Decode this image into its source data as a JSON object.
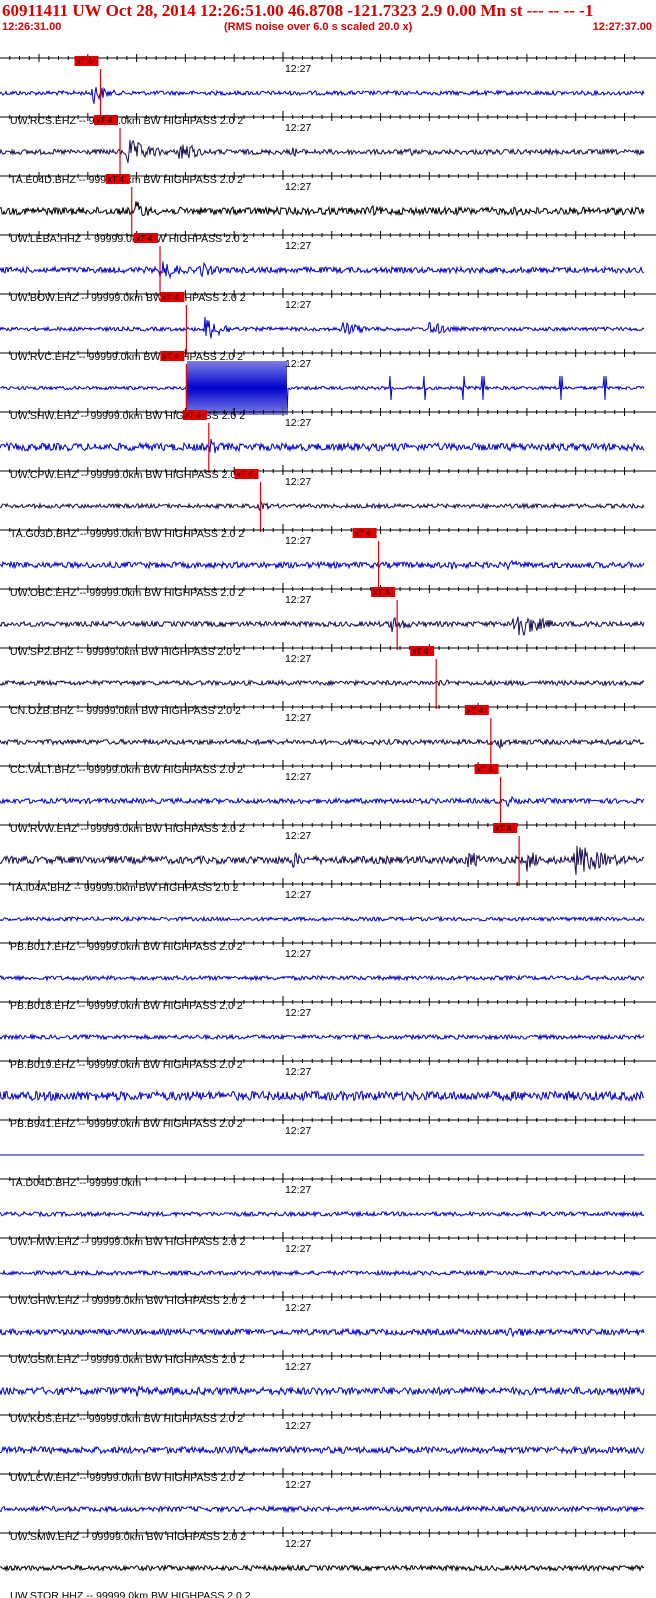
{
  "header": {
    "title": "60911411 UW Oct 28, 2014 12:26:51.00   46.8708 -121.7323  2.9 0.00 Mn st --- -- --  -1",
    "start_time": "12:26:31.00",
    "scale_note": "(RMS noise over 6.0 s scaled 20.0 x)",
    "end_time": "12:27:37.00"
  },
  "colors": {
    "title": "#d80000",
    "trace_blue": "#0000cc",
    "trace_dark": "#1a0a50",
    "trace_black": "#000000",
    "pick": "#e00000",
    "grid": "#000000"
  },
  "chart_data": {
    "type": "seismogram",
    "x_range_seconds": [
      0,
      66
    ],
    "minute_mark_label": "12:27",
    "minute_mark_second": 29,
    "traces": [
      {
        "label": "UW.RCS.EHZ -- 99999.0km BW  HIGHPASS  2.0  2",
        "pick_label": "xT 4",
        "pick_second": 10.3,
        "color": "blue",
        "level": 0.5,
        "events": [
          [
            9.5,
            2.8,
            1.5
          ]
        ]
      },
      {
        "label": "TA.E04D.BHZ -- 99999.0km BW  HIGHPASS  2.0  2",
        "pick_label": "xT 4",
        "pick_second": 12.3,
        "color": "dark",
        "level": 0.6,
        "events": [
          [
            13,
            3.5,
            2.5
          ],
          [
            18.5,
            3.5,
            1.5
          ],
          [
            30,
            1.2,
            2
          ],
          [
            42,
            1.0,
            1.5
          ]
        ]
      },
      {
        "label": "UW.LEBA.HHZ -- 99999.0km BW  HIGHPASS  2.0  2",
        "pick_label": "xT 4",
        "pick_second": 13.5,
        "color": "black",
        "level": 0.9,
        "events": [
          [
            14,
            3.0,
            1.2
          ],
          [
            38,
            1.3,
            3
          ],
          [
            53,
            1.5,
            1.5
          ]
        ]
      },
      {
        "label": "UW.BOW.EHZ -- 99999.0km BW  HIGHPASS  2.0  2",
        "pick_label": "xT 4",
        "pick_second": 16.4,
        "color": "blue",
        "level": 0.7,
        "events": [
          [
            16.5,
            2.8,
            2
          ],
          [
            20.5,
            2.0,
            2
          ]
        ]
      },
      {
        "label": "UW.RVC.EHZ -- 99999.0km BW  HIGHPASS  2.0  2",
        "pick_label": "xT 4",
        "pick_second": 19.1,
        "color": "blue",
        "level": 0.45,
        "events": [
          [
            21,
            3.2,
            2
          ],
          [
            35,
            2.0,
            2.5
          ],
          [
            44,
            2.0,
            2
          ]
        ]
      },
      {
        "label": "UW.SHW.EHZ -- 99999.0km BW  HIGHPASS  2.0  2",
        "pick_label": "xT 4",
        "pick_second": 19.1,
        "color": "blue",
        "level": 0.4,
        "clipped": [
          19.1,
          29.5
        ],
        "spikes": [
          40,
          43.5,
          47.5,
          49.5,
          57.5,
          62
        ]
      },
      {
        "label": "UW.CPW.EHZ -- 99999.0km BW  HIGHPASS  2.0  2",
        "pick_label": "xT 4",
        "pick_second": 21.4,
        "color": "blue",
        "level": 0.9,
        "events": [
          [
            21.5,
            2.2,
            1.5
          ]
        ]
      },
      {
        "label": "TA.G03D.BHZ -- 99999.0km BW  HIGHPASS  2.0  2",
        "pick_label": "xT 4",
        "pick_second": 26.7,
        "color": "dark",
        "level": 0.5,
        "events": [
          [
            26.5,
            1.3,
            1.5
          ]
        ]
      },
      {
        "label": "UW.OBC.EHZ -- 99999.0km BW  HIGHPASS  2.0  2",
        "pick_label": "xT 4",
        "pick_second": 38.8,
        "color": "blue",
        "level": 0.7,
        "events": [
          [
            46,
            1.2,
            3
          ],
          [
            52,
            1.3,
            2
          ]
        ]
      },
      {
        "label": "UW.SP2.BHZ -- 99999.0km BW  HIGHPASS  2.0  2",
        "pick_label": "xT 4",
        "pick_second": 40.7,
        "color": "dark",
        "level": 0.6,
        "events": [
          [
            40,
            2.2,
            2
          ],
          [
            52.5,
            4.5,
            2.5
          ],
          [
            60,
            1.5,
            2
          ]
        ]
      },
      {
        "label": "CN.OZB.BHZ -- 99999.0km BW  HIGHPASS  2.0  2",
        "pick_label": "xT 4",
        "pick_second": 44.7,
        "color": "dark",
        "level": 0.55,
        "events": [
          [
            45,
            1.1,
            2
          ]
        ]
      },
      {
        "label": "CC.VALT.BHZ -- 99999.0km BW  HIGHPASS  2.0  2",
        "pick_label": "xT 4",
        "pick_second": 50.3,
        "color": "dark",
        "level": 0.6,
        "events": [
          [
            51,
            1.8,
            1.5
          ]
        ]
      },
      {
        "label": "UW.RVW.EHZ -- 99999.0km BW  HIGHPASS  2.0  2",
        "pick_label": "xT 4",
        "pick_second": 51.3,
        "color": "blue",
        "level": 0.6,
        "events": [
          [
            52,
            1.3,
            1.5
          ]
        ]
      },
      {
        "label": "TA.I04A.BHZ -- 99999.0km BW  HIGHPASS  2.0  2",
        "pick_label": "xT 4",
        "pick_second": 53.2,
        "color": "dark",
        "level": 0.9,
        "events": [
          [
            30,
            2.2,
            1.5
          ],
          [
            42,
            1.8,
            1
          ],
          [
            48,
            2.5,
            1.5
          ],
          [
            54,
            2.8,
            1.5
          ],
          [
            59,
            4.0,
            3.5
          ]
        ]
      },
      {
        "label": "PB.B017.EHZ -- 99999.0km BW  HIGHPASS  2.0  2",
        "color": "blue",
        "level": 0.45
      },
      {
        "label": "PB.B018.EHZ -- 99999.0km BW  HIGHPASS  2.0  2",
        "color": "blue",
        "level": 0.5
      },
      {
        "label": "PB.B019.EHZ -- 99999.0km BW  HIGHPASS  2.0  2",
        "color": "blue",
        "level": 0.5
      },
      {
        "label": "PB.B941.EHZ -- 99999.0km BW  HIGHPASS  2.0  2",
        "color": "blue",
        "level": 1.1
      },
      {
        "label": "TA.D04D.BHZ -- 99999.0km",
        "color": "blue",
        "level": 0
      },
      {
        "label": "UW.FMW.EHZ -- 99999.0km BW  HIGHPASS  2.0  2",
        "color": "blue",
        "level": 0.5
      },
      {
        "label": "UW.GHW.EHZ -- 99999.0km BW  HIGHPASS  2.0  2",
        "color": "blue",
        "level": 0.5
      },
      {
        "label": "UW.GSM.EHZ -- 99999.0km BW  HIGHPASS  2.0  2",
        "color": "blue",
        "level": 0.7,
        "events": [
          [
            52,
            1.6,
            3
          ]
        ]
      },
      {
        "label": "UW.KOS.EHZ -- 99999.0km BW  HIGHPASS  2.0  2",
        "color": "blue",
        "level": 0.9,
        "events": [
          [
            14,
            1.4,
            2
          ]
        ]
      },
      {
        "label": "UW.LCW.EHZ -- 99999.0km BW  HIGHPASS  2.0  2",
        "color": "blue",
        "level": 0.8
      },
      {
        "label": "UW.SMW.EHZ -- 99999.0km BW  HIGHPASS  2.0  2",
        "color": "blue",
        "level": 0.6
      },
      {
        "label": "UW.STOR.HHZ -- 99999.0km BW  HIGHPASS  2.0  2",
        "color": "black",
        "level": 0.6
      }
    ]
  }
}
